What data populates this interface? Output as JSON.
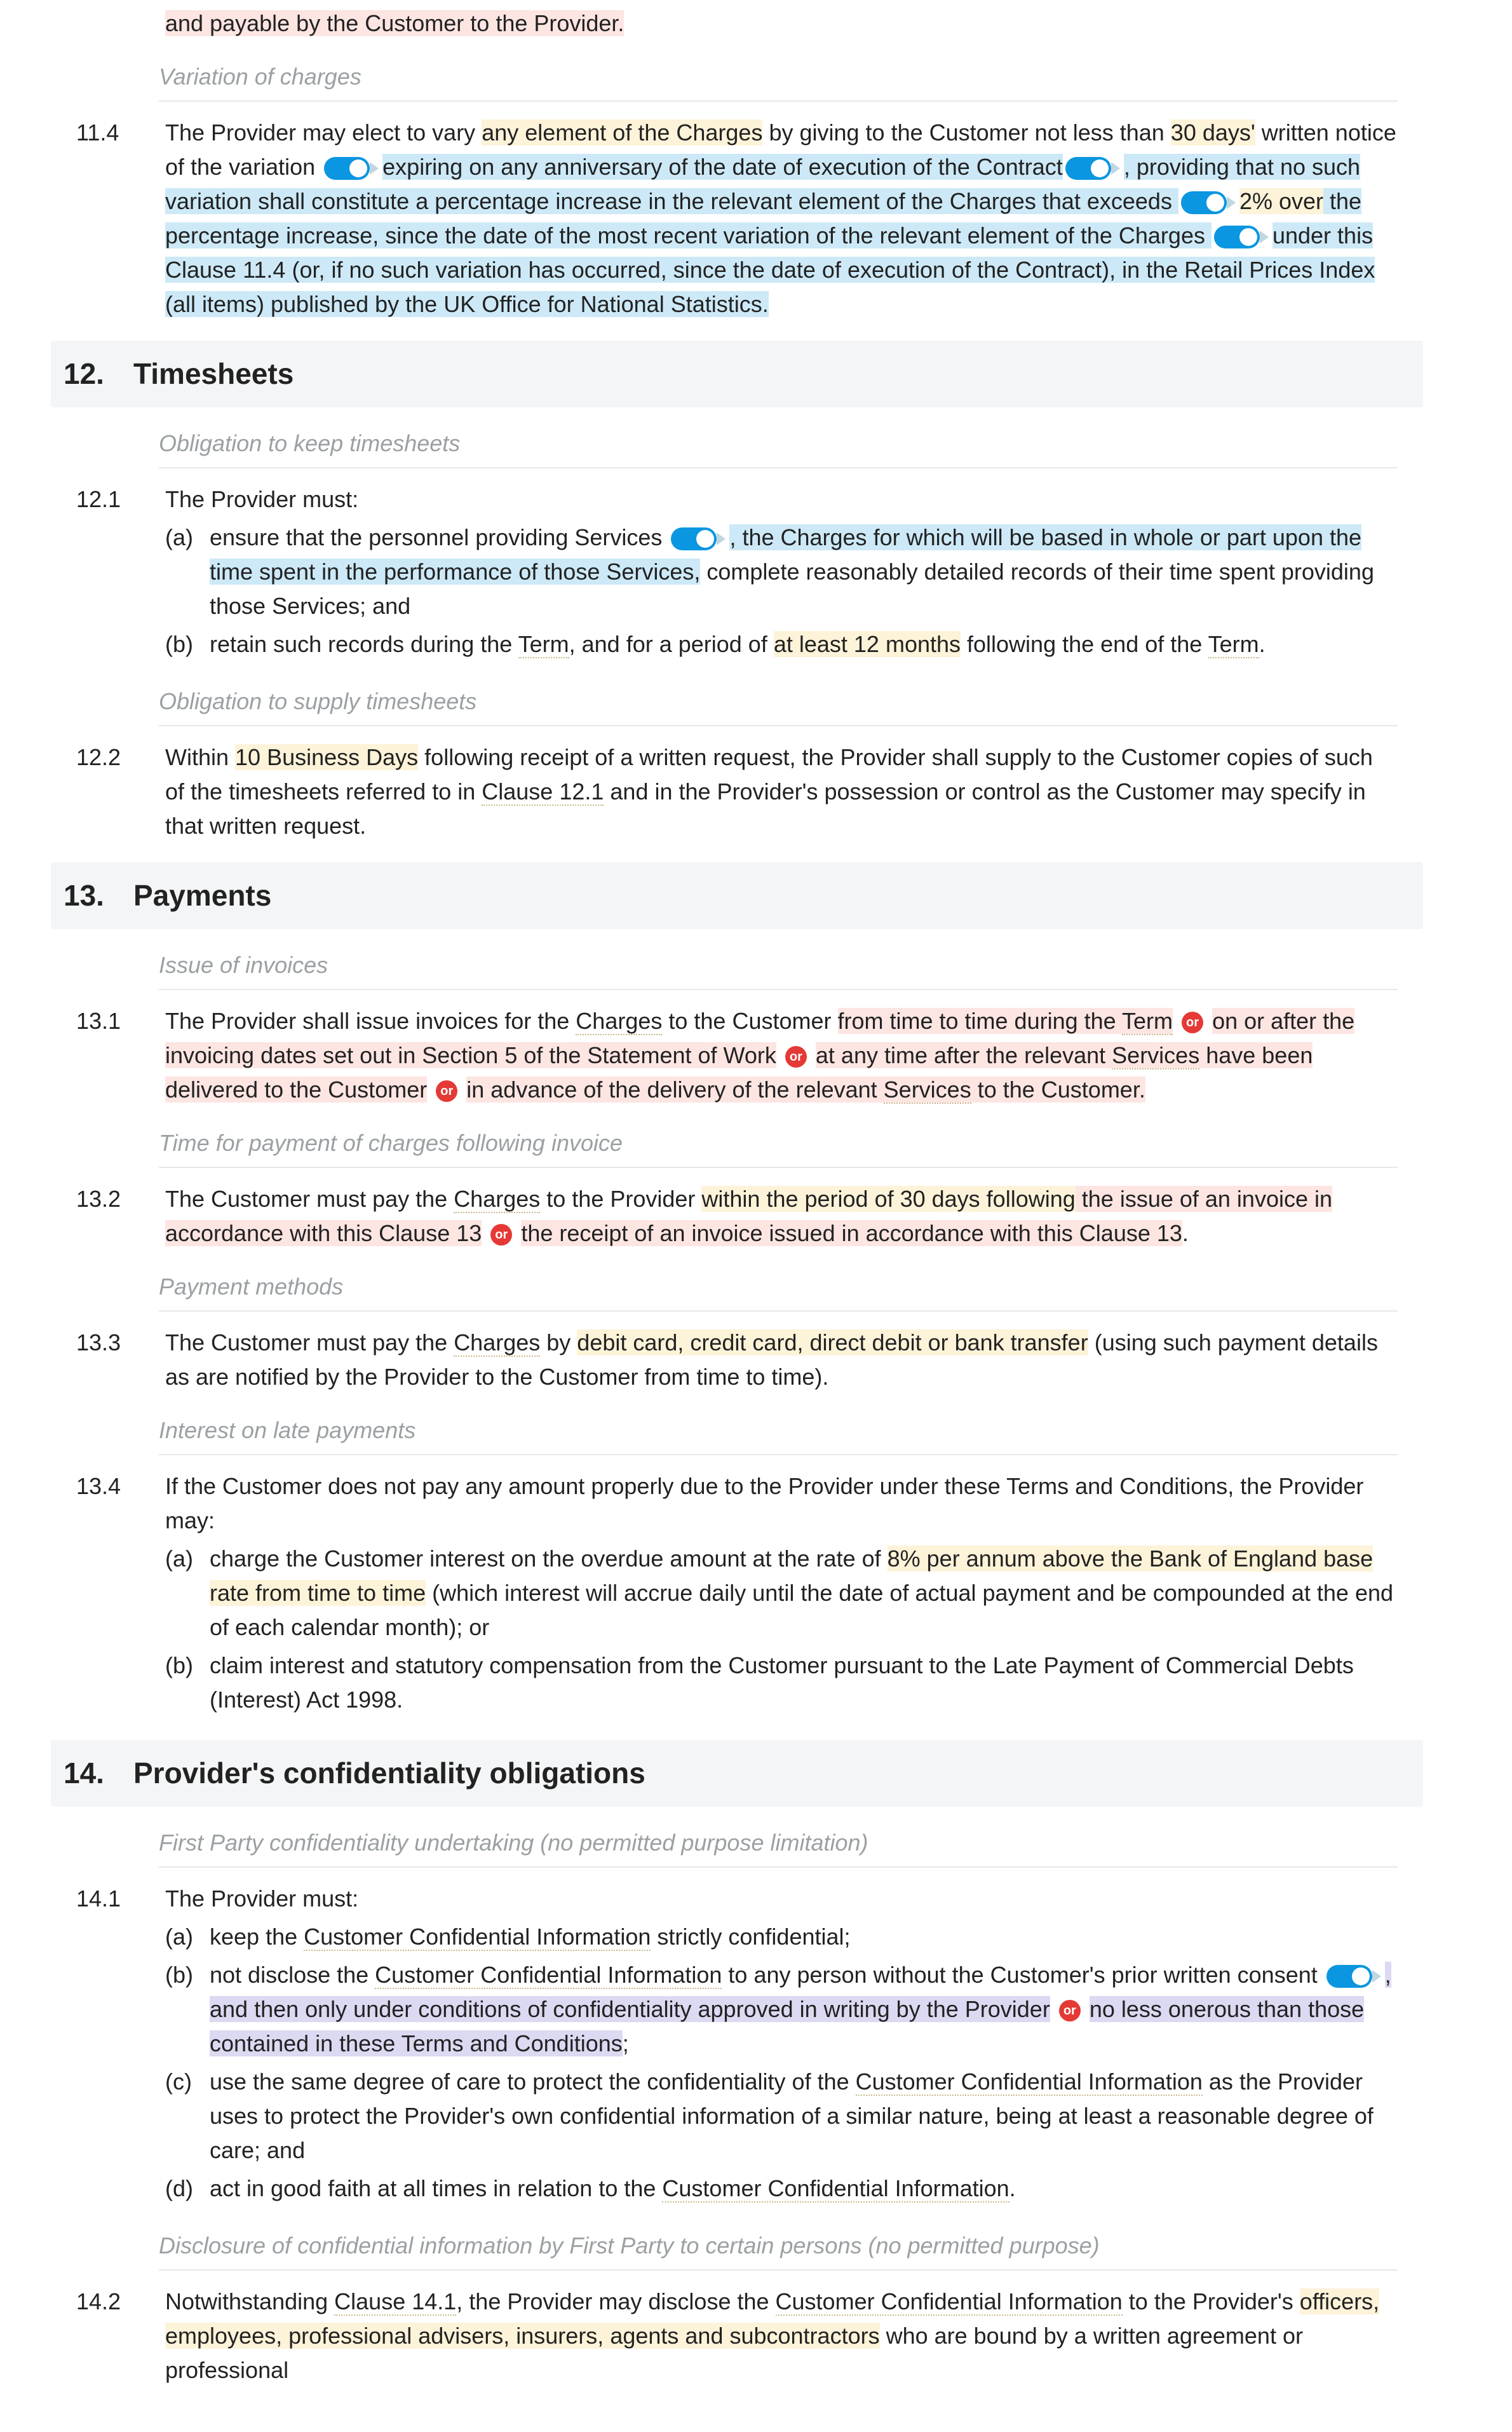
{
  "or_label": "or",
  "c11_tail": {
    "pre": "and payable by the Customer to the Provider."
  },
  "sub_variation": "Variation of charges",
  "c11_4": {
    "num": "11.4",
    "p1": "The Provider may elect to vary ",
    "p2": "any element of the Charges",
    "p3": " by giving to the Customer not less than ",
    "p4": "30 days'",
    "p5": " written notice of the variation ",
    "p6": "expiring on any anniversary of the date of execution of the Contract",
    "p7": ", providing that no such variation shall constitute a percentage increase in the relevant element of the Charges that exceeds ",
    "p8": "2% over",
    "p9": " the percentage increase, since the date of the most recent variation of the relevant element of the Charges ",
    "p10": "under this Clause 11.4",
    "p11": " (or, if no such variation has occurred, since the date of execution of the Contract), in the Retail Prices Index (all items) published by the UK Office for National Statistics."
  },
  "sec12": {
    "num": "12.",
    "title": "Timesheets"
  },
  "sub_keep_ts": "Obligation to keep timesheets",
  "c12_1": {
    "num": "12.1",
    "intro": "The Provider must:",
    "a_mark": "(a)",
    "a1": "ensure that the personnel providing Services ",
    "a2": ", the Charges for which will be based in whole or part upon the time spent in the performance of those Services,",
    "a3": " complete reasonably detailed records of their time spent providing those Services; and",
    "b_mark": "(b)",
    "b1": "retain such records during the ",
    "b2": "Term",
    "b3": ", and for a period of ",
    "b4": "at least 12 months",
    "b5": " following the end of the ",
    "b6": "Term",
    "b7": "."
  },
  "sub_supply_ts": "Obligation to supply timesheets",
  "c12_2": {
    "num": "12.2",
    "p1": "Within ",
    "p2": "10 Business Days",
    "p3": " following receipt of a written request, the Provider shall supply to the Customer copies of such of the timesheets referred to in ",
    "p4": "Clause 12.1",
    "p5": " and in the Provider's possession or control as the Customer may specify in that written request."
  },
  "sec13": {
    "num": "13.",
    "title": "Payments"
  },
  "sub_issue_inv": "Issue of invoices",
  "c13_1": {
    "num": "13.1",
    "p1": "The Provider shall issue invoices for the ",
    "p2": "Charges",
    "p3": " to the Customer ",
    "p4": "from time to time during the ",
    "p4b": "Term",
    "p5": " on or after the invoicing dates set out in Section 5 of the Statement of Work",
    "p6": " at any time after the relevant ",
    "p6b": "Services",
    "p6c": " have been delivered to the Customer",
    "p7": " in advance of the delivery of the relevant ",
    "p7b": "Services",
    "p7c": " to the Customer."
  },
  "sub_time_pay": "Time for payment of charges following invoice",
  "c13_2": {
    "num": "13.2",
    "p1": "The Customer must pay the ",
    "p2": "Charges",
    "p3": " to the Provider ",
    "p4": "within the period of 30 days following",
    "p5": " the issue of an invoice in accordance with this Clause 13",
    "p6": " the receipt of an invoice issued in accordance with this Clause 13",
    "p7": "."
  },
  "sub_pay_methods": "Payment methods",
  "c13_3": {
    "num": "13.3",
    "p1": "The Customer must pay the ",
    "p2": "Charges",
    "p3": " by ",
    "p4": "debit card, credit card, direct debit or bank transfer",
    "p5": " (using such payment details as are notified by the Provider to the Customer from time to time)."
  },
  "sub_interest": "Interest on late payments",
  "c13_4": {
    "num": "13.4",
    "intro": "If the Customer does not pay any amount properly due to the Provider under these Terms and Conditions, the Provider may:",
    "a_mark": "(a)",
    "a1": "charge the Customer interest on the overdue amount at the rate of ",
    "a2": "8% per annum above the Bank of England base rate from time to time",
    "a3": " (which interest will accrue daily until the date of actual payment and be compounded at the end of each calendar month); or",
    "b_mark": "(b)",
    "b1": "claim interest and statutory compensation from the Customer pursuant to the Late Payment of Commercial Debts (Interest) Act 1998."
  },
  "sec14": {
    "num": "14.",
    "title": "Provider's confidentiality obligations"
  },
  "sub_fp_conf": "First Party confidentiality undertaking (no permitted purpose limitation)",
  "c14_1": {
    "num": "14.1",
    "intro": "The Provider must:",
    "a_mark": "(a)",
    "a1": "keep the ",
    "a2": "Customer Confidential Information",
    "a3": " strictly confidential;",
    "b_mark": "(b)",
    "b1": "not disclose the ",
    "b2": "Customer Confidential Information",
    "b3": " to any person without the Customer's prior written consent ",
    "b4": ", and then only under conditions of confidentiality approved in writing by the Provider",
    "b5": " no less onerous than those contained in these Terms and Conditions",
    "b6": ";",
    "c_mark": "(c)",
    "c1": "use the same degree of care to protect the confidentiality of the ",
    "c2": "Customer Confidential Information",
    "c3": " as the Provider uses to protect the Provider's own confidential information of a similar nature, being at least a reasonable degree of care; and",
    "d_mark": "(d)",
    "d1": "act in good faith at all times in relation to the ",
    "d2": "Customer Confidential Information",
    "d3": "."
  },
  "sub_disclosure": "Disclosure of confidential information by First Party to certain persons (no permitted purpose)",
  "c14_2": {
    "num": "14.2",
    "p1": "Notwithstanding ",
    "p2": "Clause 14.1",
    "p3": ", the Provider may disclose the ",
    "p4": "Customer Confidential Information",
    "p5": " to the Provider's ",
    "p6": "officers, employees, professional advisers, insurers, agents and subcontractors",
    "p7": " who are bound by a written agreement or professional"
  }
}
